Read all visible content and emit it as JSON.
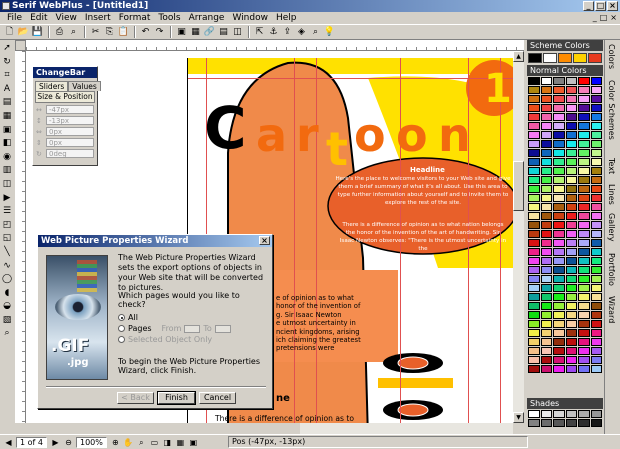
{
  "window": {
    "title": "Serif WebPlus - [Untitled1]",
    "controls": [
      "_",
      "□",
      "×"
    ]
  },
  "menubar": {
    "items": [
      "File",
      "Edit",
      "View",
      "Insert",
      "Format",
      "Tools",
      "Arrange",
      "Window",
      "Help"
    ],
    "right_controls": [
      "_",
      "□",
      "×"
    ]
  },
  "changebar": {
    "title": "ChangeBar",
    "tabs": [
      "Sliders",
      "Values"
    ],
    "active_tab": "Sliders",
    "section": "Size & Position",
    "fields": [
      {
        "icon": "↔",
        "value": "-47px"
      },
      {
        "icon": "↕",
        "value": "-13px"
      },
      {
        "icon": "⇔",
        "value": "0px"
      },
      {
        "icon": "⇕",
        "value": "0px"
      },
      {
        "icon": "↻",
        "value": "0deg"
      }
    ]
  },
  "wizard": {
    "title": "Web Picture Properties Wizard",
    "intro": "The Web Picture Properties Wizard sets the export options of objects in your Web site that will be converted to pictures.",
    "question": "Which pages would you like to check?",
    "options": [
      {
        "label": "All",
        "checked": true,
        "disabled": false
      },
      {
        "label": "Pages",
        "checked": false,
        "disabled": false
      },
      {
        "label": "Selected Object Only",
        "checked": false,
        "disabled": true
      }
    ],
    "from_label": "From",
    "to_label": "To",
    "finish_note": "To begin the Web Picture Properties Wizard, click Finish.",
    "art_text": [
      ".GIF",
      ".jpg"
    ],
    "buttons": {
      "back": "< Back",
      "finish": "Finish",
      "cancel": "Cancel"
    }
  },
  "document": {
    "title_letters": [
      "C",
      "a",
      "r",
      "t",
      "o",
      "o",
      "n"
    ],
    "number_badge": "1",
    "headline": "Headline",
    "oval_text_1": "Here's the place to welcome visitors to your Web site and give them a brief summary of what it's all about. Use this area to type further information about yourself and to invite them to explore the rest of the site.",
    "oval_text_2": "There is a difference of opinion as to what nation belongs the honor of the invention of the art of handwriting. Sir Isaac Newton observes: \"There is the utmost uncertainty in the",
    "orange_text": "e of opinion as to what\nhonor of the invention of\ng. Sir Isaac Newton\ne utmost uncertainty in\nncient kingdoms, arising\nich claiming the greatest\npretensions were",
    "lower_heading": "ne",
    "lower_body": "There is a difference of opinion as to"
  },
  "statusbar": {
    "page_indicator": "1 of 4",
    "zoom": "100%",
    "position": "Pos (-47px, -13px)"
  },
  "panels": {
    "scheme_colors_title": "Scheme Colors",
    "normal_colors_title": "Normal Colors",
    "shades_title": "Shades",
    "side_tabs": [
      "Colors",
      "Color Schemes",
      "Text",
      "Lines",
      "Gallery",
      "Portfolio",
      "Wizard"
    ],
    "scheme_swatches": [
      "#000000",
      "#ffffff",
      "#ff8c00",
      "#ffd200",
      "#e83a1e"
    ],
    "accent": "#f26a0f",
    "yellow": "#ffe100",
    "title_bar_color": "#0a246a"
  }
}
